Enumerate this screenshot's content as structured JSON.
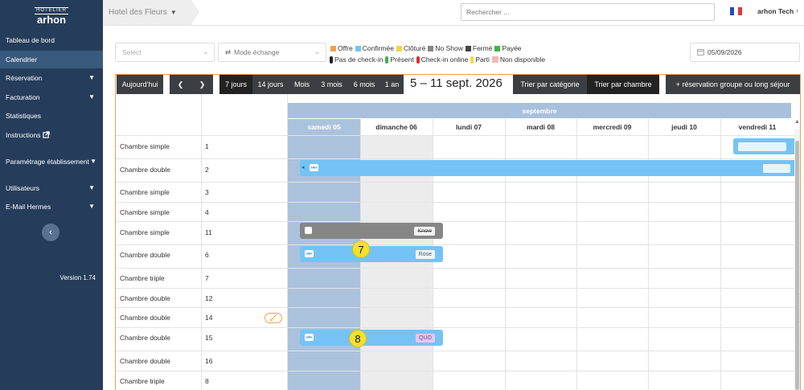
{
  "sidebar": {
    "logo_top": "HOTELIER",
    "logo_main": "arhon",
    "items": [
      {
        "label": "Tableau de bord",
        "chevron": false
      },
      {
        "label": "Calendrier",
        "chevron": false,
        "active": true
      },
      {
        "label": "Réservation",
        "chevron": true
      },
      {
        "label": "Facturation",
        "chevron": true
      },
      {
        "label": "Statistiques",
        "chevron": false
      },
      {
        "label": "Instructions",
        "chevron": false
      },
      {
        "label": "Paramétrage établissement",
        "chevron": true
      },
      {
        "label": "Utilisateurs",
        "chevron": true
      },
      {
        "label": "E-Mail Hermes",
        "chevron": true
      }
    ],
    "version": "Version 1.74"
  },
  "topbar": {
    "hotel": "Hotel des Fleurs",
    "search_placeholder": "Rechercher ...",
    "user": "arhon Tech"
  },
  "filters": {
    "select_placeholder": "Select",
    "mode": "Mode échange",
    "date": "05/09/2026"
  },
  "legend": {
    "statuses": [
      {
        "label": "Offre",
        "color": "#f0a04b"
      },
      {
        "label": "Confirmée",
        "color": "#75c3f5"
      },
      {
        "label": "Clôturé",
        "color": "#f5d442"
      },
      {
        "label": "No Show",
        "color": "#868686"
      },
      {
        "label": "Fermé",
        "color": "#444444"
      },
      {
        "label": "Payée",
        "color": "#3bb34a"
      }
    ],
    "checkins": [
      {
        "label": "Pas de check-in",
        "color": "#222222"
      },
      {
        "label": "Présent",
        "color": "#3bb34a"
      },
      {
        "label": "Check-in online",
        "color": "#d9302c"
      },
      {
        "label": "Parti",
        "color": "#f5d442"
      },
      {
        "label": "Non disponible",
        "color": "#f2b8b8",
        "square": true
      }
    ]
  },
  "toolbar": {
    "today": "Aujourd'hui",
    "prev": "❮",
    "next": "❯",
    "ranges": [
      "7 jours",
      "14 jours",
      "Mois",
      "3 mois",
      "6 mois",
      "1 an"
    ],
    "period": "5 – 11 sept. 2026",
    "sort_category": "Trier par catégorie",
    "sort_room": "Trier par chambre",
    "group_booking": "+ réservation groupe ou long séjour"
  },
  "calendar": {
    "month": "septembre",
    "days": [
      "samedi 05",
      "dimanche 06",
      "lundi 07",
      "mardi 08",
      "mercredi 09",
      "jeudi 10",
      "vendredi 11"
    ],
    "rooms": [
      {
        "type": "Chambre simple",
        "number": "1"
      },
      {
        "type": "Chambre double",
        "number": "2"
      },
      {
        "type": "Chambre simple",
        "number": "3"
      },
      {
        "type": "Chambre simple",
        "number": "4"
      },
      {
        "type": "Chambre simple",
        "number": "11"
      },
      {
        "type": "Chambre double",
        "number": "6"
      },
      {
        "type": "Chambre triple",
        "number": "7"
      },
      {
        "type": "Chambre double",
        "number": "12"
      },
      {
        "type": "Chambre double",
        "number": "14"
      },
      {
        "type": "Chambre double",
        "number": "15"
      },
      {
        "type": "Chambre double",
        "number": "16"
      },
      {
        "type": "Chambre triple",
        "number": "8"
      }
    ],
    "bookings": [
      {
        "label": "Know",
        "status": "No Show"
      },
      {
        "label": "Rose",
        "status": "Confirmée",
        "badge": "7"
      },
      {
        "label": "QUO",
        "status": "Confirmée",
        "badge": "8"
      }
    ]
  }
}
